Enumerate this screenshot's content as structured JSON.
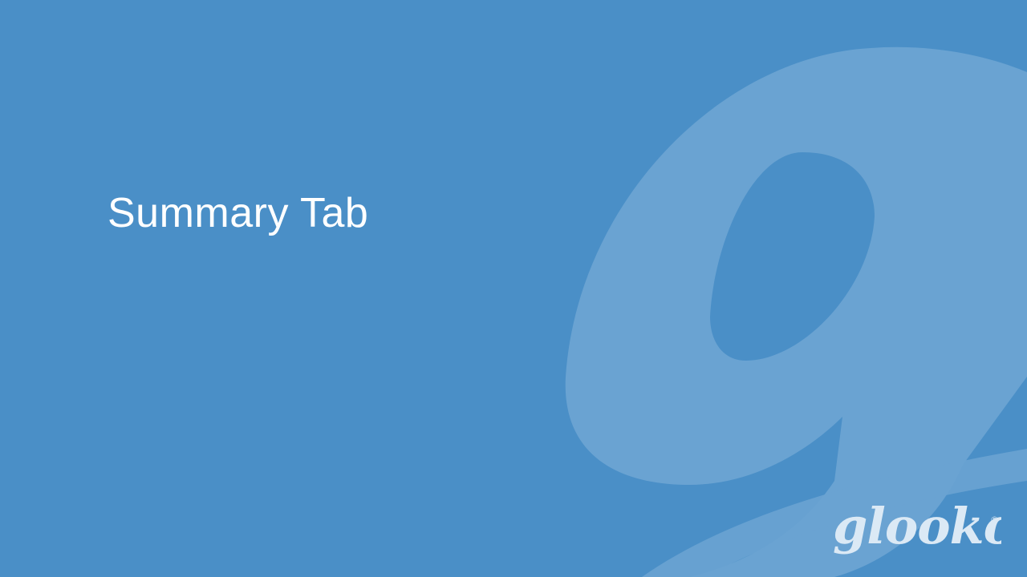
{
  "slide": {
    "title": "Summary Tab",
    "background_color": "#4a8fc7",
    "watermark_color": "#6aa3d2"
  },
  "brand": {
    "logo_text": "glooko",
    "registered_mark": "®",
    "logo_color": "#dbe9f5"
  }
}
